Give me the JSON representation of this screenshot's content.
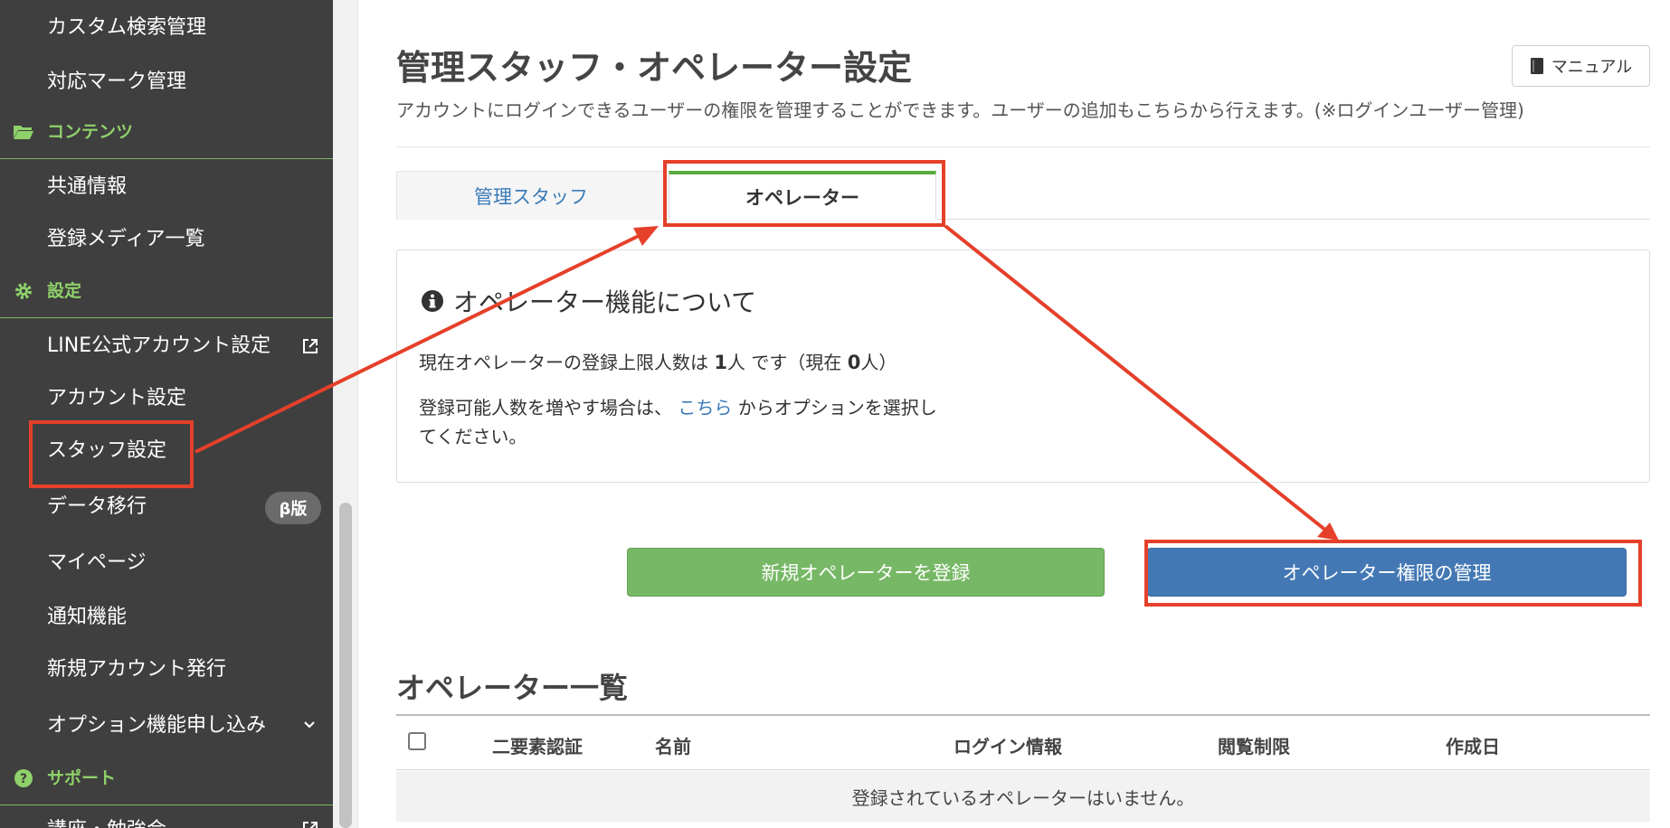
{
  "sidebar": {
    "items_top": [
      {
        "label": "カスタム検索管理"
      },
      {
        "label": "対応マーク管理"
      }
    ],
    "section_contents": {
      "label": "コンテンツ"
    },
    "items_contents": [
      {
        "label": "共通情報"
      },
      {
        "label": "登録メディア一覧"
      }
    ],
    "section_settings": {
      "label": "設定"
    },
    "items_settings": [
      {
        "label": "LINE公式アカウント設定"
      },
      {
        "label": "アカウント設定"
      },
      {
        "label": "スタッフ設定"
      },
      {
        "label": "データ移行",
        "badge": "β版"
      },
      {
        "label": "マイページ"
      },
      {
        "label": "通知機能"
      },
      {
        "label": "新規アカウント発行"
      },
      {
        "label": "オプション機能申し込み"
      }
    ],
    "section_support": {
      "label": "サポート"
    },
    "items_support": [
      {
        "label": "講座・勉強会"
      }
    ]
  },
  "header": {
    "title": "管理スタッフ・オペレーター設定",
    "description": "アカウントにログインできるユーザーの権限を管理することができます。ユーザーの追加もこちらから行えます。(※ログインユーザー管理)",
    "manual_label": "マニュアル"
  },
  "tabs": [
    {
      "label": "管理スタッフ",
      "active": false
    },
    {
      "label": "オペレーター",
      "active": true
    }
  ],
  "info": {
    "title": "オペレーター機能について",
    "line1_prefix": "現在オペレーターの登録上限人数は",
    "limit_number": "1",
    "line1_unit": "人",
    "line1_mid": "です（現在",
    "current_number": "0",
    "line1_suffix": "人）",
    "line2_prefix": "登録可能人数を増やす場合は、",
    "line2_link": "こちら",
    "line2_suffix": "からオプションを選択し",
    "line3": "てください。"
  },
  "buttons": {
    "register": "新規オペレーターを登録",
    "manage": "オペレーター権限の管理"
  },
  "list": {
    "title": "オペレーター一覧",
    "columns": [
      "二要素認証",
      "名前",
      "ログイン情報",
      "閲覧制限",
      "作成日"
    ],
    "empty_message": "登録されているオペレーターはいません。"
  },
  "colors": {
    "sidebar_bg": "#3f3f3f",
    "accent_green": "#8fd16a",
    "register_green": "#77b866",
    "manage_blue": "#4378b4",
    "annotation_red": "#e5402a"
  }
}
